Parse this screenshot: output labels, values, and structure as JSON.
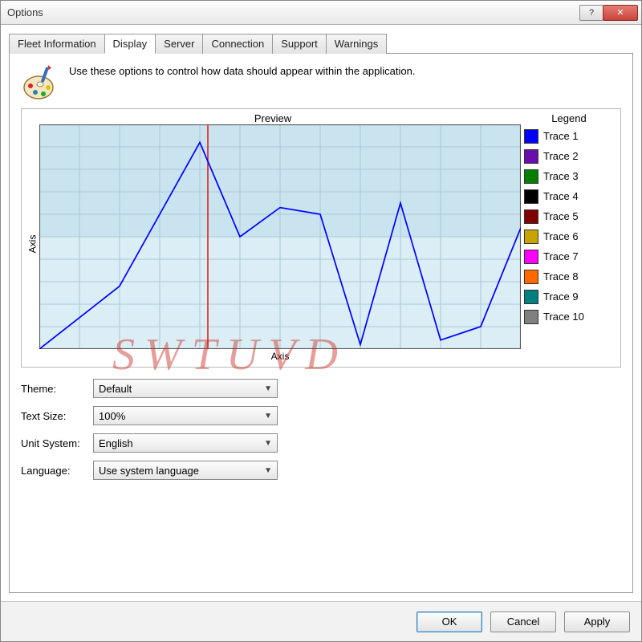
{
  "window": {
    "title": "Options",
    "help_glyph": "?",
    "close_glyph": "✕"
  },
  "tabs": [
    {
      "label": "Fleet Information",
      "active": false
    },
    {
      "label": "Display",
      "active": true
    },
    {
      "label": "Server",
      "active": false
    },
    {
      "label": "Connection",
      "active": false
    },
    {
      "label": "Support",
      "active": false
    },
    {
      "label": "Warnings",
      "active": false
    }
  ],
  "description": "Use these options to control how data should appear within the application.",
  "preview": {
    "title": "Preview",
    "legend_title": "Legend",
    "x_axis": "Axis",
    "y_axis": "Axis"
  },
  "legend": [
    {
      "label": "Trace 1",
      "color": "#0000ff"
    },
    {
      "label": "Trace 2",
      "color": "#6a0dad"
    },
    {
      "label": "Trace 3",
      "color": "#008000"
    },
    {
      "label": "Trace 4",
      "color": "#000000"
    },
    {
      "label": "Trace 5",
      "color": "#800000"
    },
    {
      "label": "Trace 6",
      "color": "#c9a400"
    },
    {
      "label": "Trace 7",
      "color": "#ff00ff"
    },
    {
      "label": "Trace 8",
      "color": "#ff6a00"
    },
    {
      "label": "Trace 9",
      "color": "#008080"
    },
    {
      "label": "Trace 10",
      "color": "#808080"
    }
  ],
  "chart_data": {
    "type": "line",
    "title": "Preview",
    "xlabel": "Axis",
    "ylabel": "Axis",
    "xlim": [
      0,
      12
    ],
    "ylim": [
      0,
      10
    ],
    "grid": true,
    "cursor_x": 4.2,
    "series": [
      {
        "name": "Trace 1",
        "color": "#0000ff",
        "x": [
          0,
          1,
          2,
          3,
          4,
          5,
          6,
          7,
          8,
          9,
          10,
          11,
          12
        ],
        "values": [
          0,
          1.4,
          2.8,
          6.0,
          9.2,
          5.0,
          6.3,
          6.0,
          0.2,
          6.5,
          0.4,
          1.0,
          5.4
        ]
      }
    ],
    "legend_position": "right"
  },
  "form": {
    "theme": {
      "label": "Theme:",
      "value": "Default"
    },
    "text_size": {
      "label": "Text Size:",
      "value": "100%"
    },
    "unit_system": {
      "label": "Unit System:",
      "value": "English"
    },
    "language": {
      "label": "Language:",
      "value": "Use system language"
    }
  },
  "buttons": {
    "ok": "OK",
    "cancel": "Cancel",
    "apply": "Apply"
  },
  "watermark": "SWTUVD"
}
